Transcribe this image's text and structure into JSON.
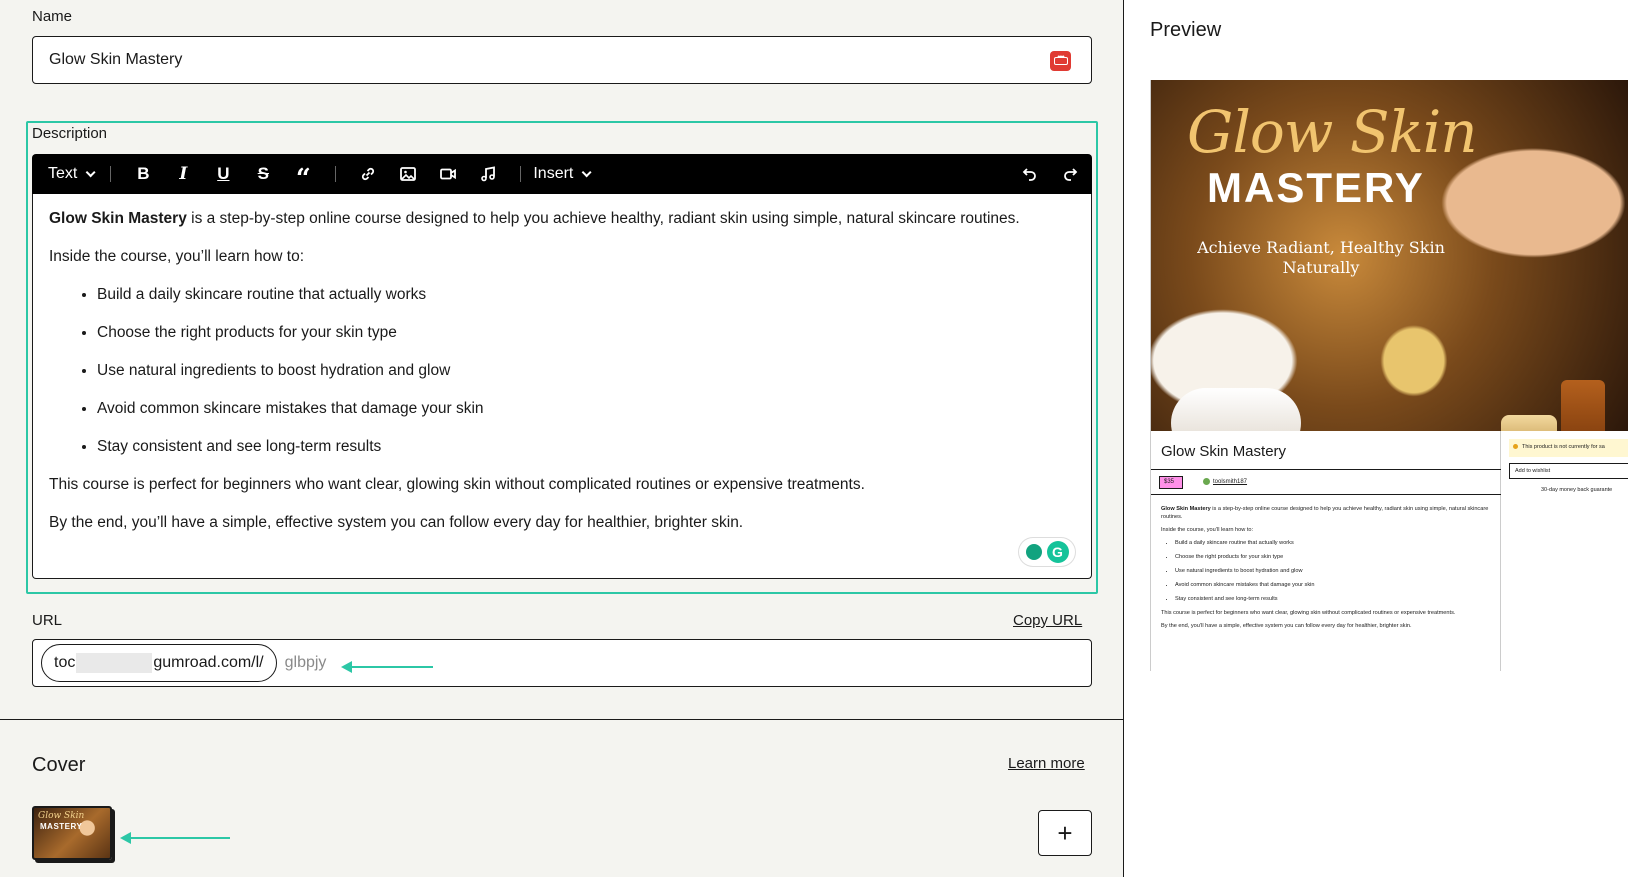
{
  "name_field": {
    "label": "Name",
    "value": "Glow Skin Mastery"
  },
  "description_field": {
    "label": "Description",
    "toolbar": {
      "text_style_label": "Text",
      "insert_label": "Insert",
      "icons": [
        "bold-icon",
        "italic-icon",
        "underline-icon",
        "strikethrough-icon",
        "quote-icon",
        "link-icon",
        "image-icon",
        "video-icon",
        "music-icon",
        "undo-icon",
        "redo-icon"
      ]
    },
    "intro_bold": "Glow Skin Mastery",
    "intro_rest": " is a step-by-step online course designed to help you achieve healthy, radiant skin using simple, natural skincare routines.",
    "learn_heading": "Inside the course, you’ll learn how to:",
    "bullets": [
      "Build a daily skincare routine that actually works",
      "Choose the right products for your skin type",
      "Use natural ingredients to boost hydration and glow",
      "Avoid common skincare mistakes that damage your skin",
      "Stay consistent and see long-term results"
    ],
    "audience": "This course is perfect for beginners who want clear, glowing skin without complicated routines or expensive treatments.",
    "closing": "By the end, you’ll have a simple, effective system you can follow every day for healthier, brighter skin."
  },
  "url_field": {
    "label": "URL",
    "copy_label": "Copy URL",
    "prefix_start": "toc",
    "prefix_end": "gumroad.com/l/",
    "slug": "glbpjy"
  },
  "cover": {
    "title": "Cover",
    "learn_more": "Learn more",
    "add_symbol": "+",
    "thumb_title": "Glow Skin",
    "thumb_subtitle": "MASTERY"
  },
  "preview": {
    "title": "Preview",
    "hero_title": "Glow Skin",
    "hero_subtitle": "MASTERY",
    "hero_tagline": "Achieve Radiant, Healthy Skin Naturally",
    "product_name": "Glow Skin Mastery",
    "price": "$35",
    "author": "toolsmith187",
    "warning": "This product is not currently for sa",
    "wishlist": "Add to wishlist",
    "guarantee": "30-day money back guarante"
  },
  "colors": {
    "accent": "#2cc7a6",
    "price_tag": "#ff90e8",
    "toolbar": "#000000"
  }
}
